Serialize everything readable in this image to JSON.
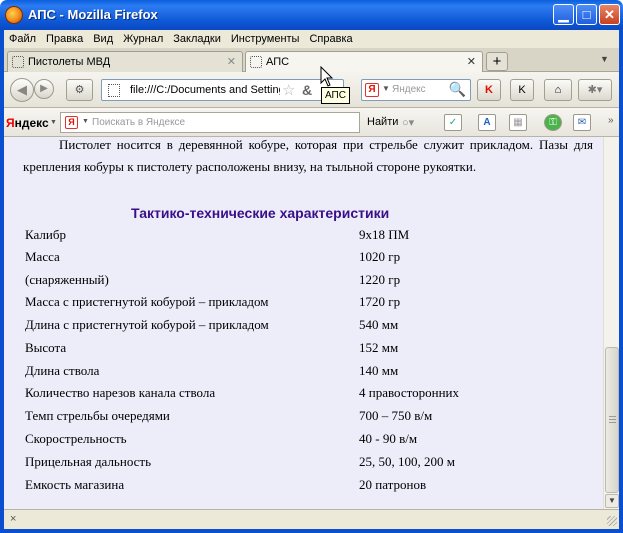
{
  "window": {
    "title": "АПС - Mozilla Firefox",
    "minimize_icon": "minimize-icon",
    "maximize_icon": "maximize-icon",
    "close_icon": "close-icon"
  },
  "menu": [
    "Файл",
    "Правка",
    "Вид",
    "Журнал",
    "Закладки",
    "Инструменты",
    "Справка"
  ],
  "tabs": [
    {
      "label": "Пистолеты МВД",
      "active": false
    },
    {
      "label": "АПС",
      "active": true
    }
  ],
  "nav": {
    "url": "file:///C:/Documents and Settings",
    "tooltip": "АПС",
    "search_placeholder": "Яндекс",
    "search_engine_glyph": "Я"
  },
  "yandex_toolbar": {
    "brand_y": "Я",
    "brand_rest": "ндекс",
    "engine_glyph": "Я",
    "placeholder": "Поискать в Яндексе",
    "find_label": "Найти"
  },
  "content": {
    "intro_text": "Пистолет носится в деревянной кобуре, которая при стрельбе служит прикладом. Пазы для крепления кобуры к пистолету расположены внизу, на тыльной стороне рукоятки.",
    "specs_title": "Тактико-технические характеристики",
    "specs": [
      {
        "label": "Калибр",
        "value": "9х18 ПМ"
      },
      {
        "label": "Масса",
        "value": "1020 гр"
      },
      {
        "label": "(снаряженный)",
        "value": "1220 гр"
      },
      {
        "label": "Масса с пристегнутой кобурой – прикладом",
        "value": "1720 гр"
      },
      {
        "label": "Длина с пристегнутой кобурой – прикладом",
        "value": "540 мм"
      },
      {
        "label": "Высота",
        "value": "152 мм"
      },
      {
        "label": "Длина ствола",
        "value": "140 мм"
      },
      {
        "label": "Количество нарезов канала ствола",
        "value": "4 правосторонних"
      },
      {
        "label": "Темп стрельбы очередями",
        "value": "700 – 750 в/м"
      },
      {
        "label": "Скорострельность",
        "value": "40 - 90 в/м"
      },
      {
        "label": "Прицельная дальность",
        "value": "25, 50, 100, 200 м"
      },
      {
        "label": "Емкость магазина",
        "value": "20 патронов"
      }
    ]
  },
  "statusbar": {
    "close_glyph": "×"
  },
  "colors": {
    "titlebar": "#0e58d6",
    "content_bg": "#ededfa",
    "specs_title": "#3a0f8a"
  }
}
